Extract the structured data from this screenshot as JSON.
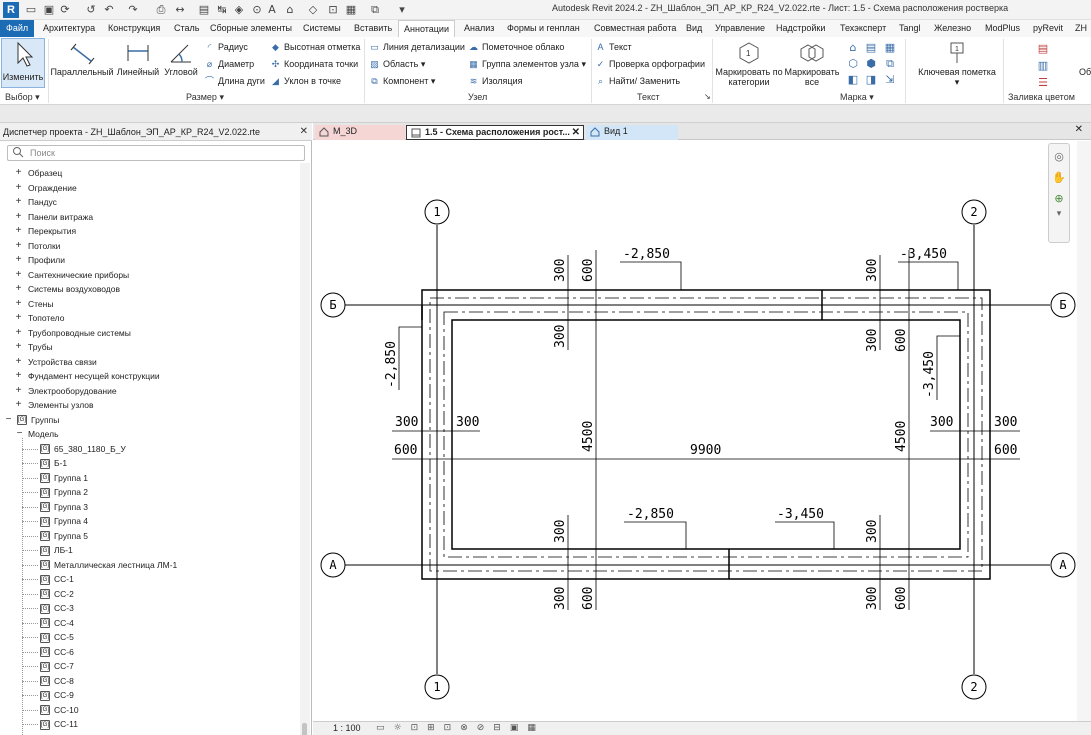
{
  "title": "Autodesk Revit 2024.2 - ZH_Шаблон_ЭП_АР_КР_R24_V2.022.rte - Лист: 1.5 - Схема расположения ростверка",
  "app_logo": "R",
  "menu": {
    "file": "Файл",
    "tabs": [
      "Архитектура",
      "Конструкция",
      "Сталь",
      "Сборные элементы",
      "Системы",
      "Вставить",
      "Аннотации",
      "Анализ",
      "Формы и генплан",
      "Совместная работа",
      "Вид",
      "Управление",
      "Надстройки",
      "Техэксперт",
      "Tangl",
      "Железно",
      "ModPlus",
      "pyRevit",
      "ZH"
    ],
    "active_tab": "Аннотации"
  },
  "ribbon": {
    "select": {
      "modify": "Изменить",
      "panel": "Выбор"
    },
    "dimension": {
      "parallel": "Параллельный",
      "linear": "Линейный",
      "angular": "Угловой",
      "radius": "Радиус",
      "diameter": "Диаметр",
      "arc_length": "Длина дуги",
      "spot_elevation": "Высотная отметка",
      "spot_coordinate": "Координата точки",
      "spot_slope": "Уклон  в точке",
      "panel": "Размер"
    },
    "detail": {
      "detail_line": "Линия детализации",
      "region": "Область",
      "component": "Компонент",
      "revision_cloud": "Пометочное облако",
      "detail_group": "Группа элементов узла",
      "insulation": "Изоляция",
      "panel": "Узел"
    },
    "text": {
      "text": "Текст",
      "spelling": "Проверка  орфографии",
      "find_replace": "Найти/ Заменить",
      "panel": "Текст"
    },
    "tag": {
      "by_category": "Маркировать по категории",
      "all": "Маркировать все",
      "panel": "Марка"
    },
    "keynote": {
      "label": "Ключевая пометка"
    },
    "color_fill": {
      "panel": "Заливка цветом",
      "cut": "Об"
    }
  },
  "browser": {
    "title": "Диспетчер проекта - ZH_Шаблон_ЭП_АР_КР_R24_V2.022.rte",
    "search_placeholder": "Поиск",
    "categories": [
      "Образец",
      "Ограждение",
      "Пандус",
      "Панели витража",
      "Перекрытия",
      "Потолки",
      "Профили",
      "Сантехнические приборы",
      "Системы воздуховодов",
      "Стены",
      "Топотело",
      "Трубопроводные системы",
      "Трубы",
      "Устройства связи",
      "Фундамент несущей конструкции",
      "Электрооборудование",
      "Элементы узлов"
    ],
    "groups_label": "Группы",
    "model_label": "Модель",
    "group_items": [
      "65_380_1180_Б_У",
      "Б-1",
      "Группа 1",
      "Группа 2",
      "Группа 3",
      "Группа 4",
      "Группа 5",
      "ЛБ-1",
      "Металлическая лестница ЛМ-1",
      "СС-1",
      "СС-2",
      "СС-3",
      "СС-4",
      "СС-5",
      "СС-6",
      "СС-7",
      "СС-8",
      "СС-9",
      "СС-10",
      "СС-11"
    ]
  },
  "view_tabs": [
    {
      "label": "M_3D",
      "active": false,
      "color": "#f6d5d5"
    },
    {
      "label": "1.5 - Схема расположения рост...",
      "active": true,
      "color": "#ffffff"
    },
    {
      "label": "Вид 1",
      "active": false,
      "color": "#d3e6f7"
    }
  ],
  "status": {
    "scale": "1 : 100"
  },
  "drawing": {
    "grid_top_left": "1",
    "grid_top_right": "2",
    "grid_bottom_left": "1",
    "grid_bottom_right": "2",
    "grid_left_top": "Б",
    "grid_right_top": "Б",
    "grid_left_bottom": "А",
    "grid_right_bottom": "А",
    "elev_top_left": "-2,850",
    "elev_top_right": "-3,450",
    "elev_left": "-2,850",
    "elev_right": "-3,450",
    "elev_bottom_left": "-2,850",
    "elev_bottom_right": "-3,450",
    "dim_300": "300",
    "dim_600": "600",
    "dim_4500": "4500",
    "dim_9900": "9900"
  }
}
